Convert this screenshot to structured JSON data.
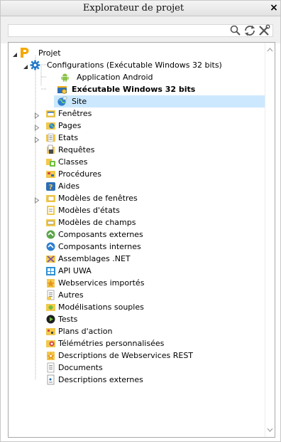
{
  "window": {
    "title": "Explorateur de projet",
    "close_label": "×"
  },
  "toolbar": {
    "icons": [
      "search-icon",
      "refresh-icon",
      "tools-icon"
    ]
  },
  "tree": {
    "root": {
      "label": "Projet",
      "icon": "project-p-icon",
      "expanded": true
    },
    "configurations": {
      "label": "Configurations (Exécutable Windows 32 bits)",
      "icon": "gear-icon",
      "expanded": true,
      "children": [
        {
          "label": "Application Android",
          "icon": "android-icon",
          "bold": false
        },
        {
          "label": "Exécutable Windows 32 bits",
          "icon": "windows-exe-icon",
          "bold": true
        },
        {
          "label": "Site",
          "icon": "website-icon",
          "bold": false,
          "selected": true
        }
      ]
    },
    "items": [
      {
        "label": "Fenêtres",
        "icon": "window-folder-icon",
        "expandable": true
      },
      {
        "label": "Pages",
        "icon": "pages-folder-icon",
        "expandable": true
      },
      {
        "label": "Etats",
        "icon": "reports-folder-icon",
        "expandable": true
      },
      {
        "label": "Requêtes",
        "icon": "queries-icon",
        "expandable": false
      },
      {
        "label": "Classes",
        "icon": "classes-icon",
        "expandable": false
      },
      {
        "label": "Procédures",
        "icon": "procedures-icon",
        "expandable": false
      },
      {
        "label": "Aides",
        "icon": "help-icon",
        "expandable": false
      },
      {
        "label": "Modèles de fenêtres",
        "icon": "window-templates-icon",
        "expandable": true
      },
      {
        "label": "Modèles d'états",
        "icon": "report-templates-icon",
        "expandable": false
      },
      {
        "label": "Modèles de champs",
        "icon": "field-templates-icon",
        "expandable": false
      },
      {
        "label": "Composants externes",
        "icon": "external-components-icon",
        "expandable": false
      },
      {
        "label": "Composants internes",
        "icon": "internal-components-icon",
        "expandable": false
      },
      {
        "label": "Assemblages .NET",
        "icon": "dotnet-assemblies-icon",
        "expandable": false
      },
      {
        "label": "API UWA",
        "icon": "uwa-api-icon",
        "expandable": false
      },
      {
        "label": "Webservices importés",
        "icon": "webservices-icon",
        "expandable": false
      },
      {
        "label": "Autres",
        "icon": "other-files-icon",
        "expandable": false
      },
      {
        "label": "Modélisations souples",
        "icon": "flexible-models-icon",
        "expandable": false
      },
      {
        "label": "Tests",
        "icon": "tests-icon",
        "expandable": false
      },
      {
        "label": "Plans d'action",
        "icon": "action-plans-icon",
        "expandable": false
      },
      {
        "label": "Télémétries personnalisées",
        "icon": "telemetry-icon",
        "expandable": false
      },
      {
        "label": "Descriptions de Webservices REST",
        "icon": "rest-webservices-icon",
        "expandable": false
      },
      {
        "label": "Documents",
        "icon": "documents-icon",
        "expandable": false
      },
      {
        "label": "Descriptions externes",
        "icon": "external-descriptions-icon",
        "expandable": false
      }
    ]
  },
  "colors": {
    "selection": "#cce8ff",
    "tree_border": "#a8a8a8",
    "project_orange": "#f5a800",
    "gear_blue": "#1f78c8",
    "android_green": "#8bc34a",
    "folder_yellow": "#f2c94c"
  }
}
